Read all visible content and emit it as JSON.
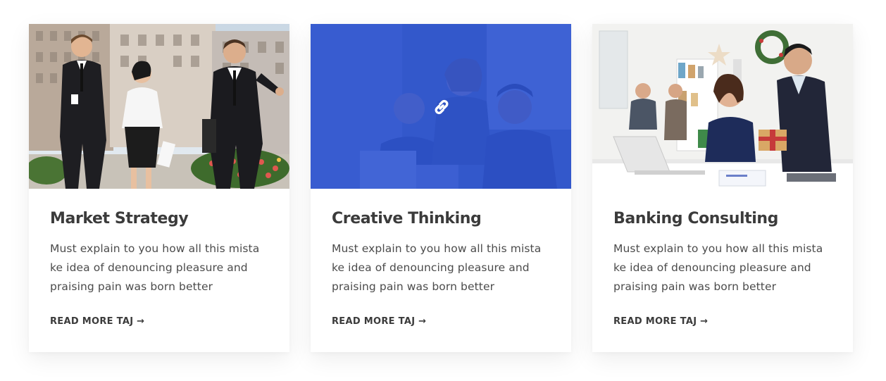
{
  "theme": {
    "overlay_color": "#2c54d6",
    "heading_color": "#3b3b3b",
    "text_color": "#4b4b4b"
  },
  "cards": [
    {
      "title": "Market Strategy",
      "description": "Must explain to you how all this mista ke idea of denouncing pleasure and praising pain was born better",
      "link_label": "READ MORE TAJ →",
      "image": "business-team-walking-photo"
    },
    {
      "title": "Creative Thinking",
      "description": "Must explain to you how all this mista ke idea of denouncing pleasure and praising pain was born better",
      "link_label": "READ MORE TAJ →",
      "image": "team-meeting-laptop-photo",
      "hover_icon": "link-icon"
    },
    {
      "title": "Banking Consulting",
      "description": "Must explain to you how all this mista ke idea of denouncing pleasure and praising pain was born better",
      "link_label": "READ MORE TAJ →",
      "image": "office-gift-handover-photo"
    }
  ]
}
